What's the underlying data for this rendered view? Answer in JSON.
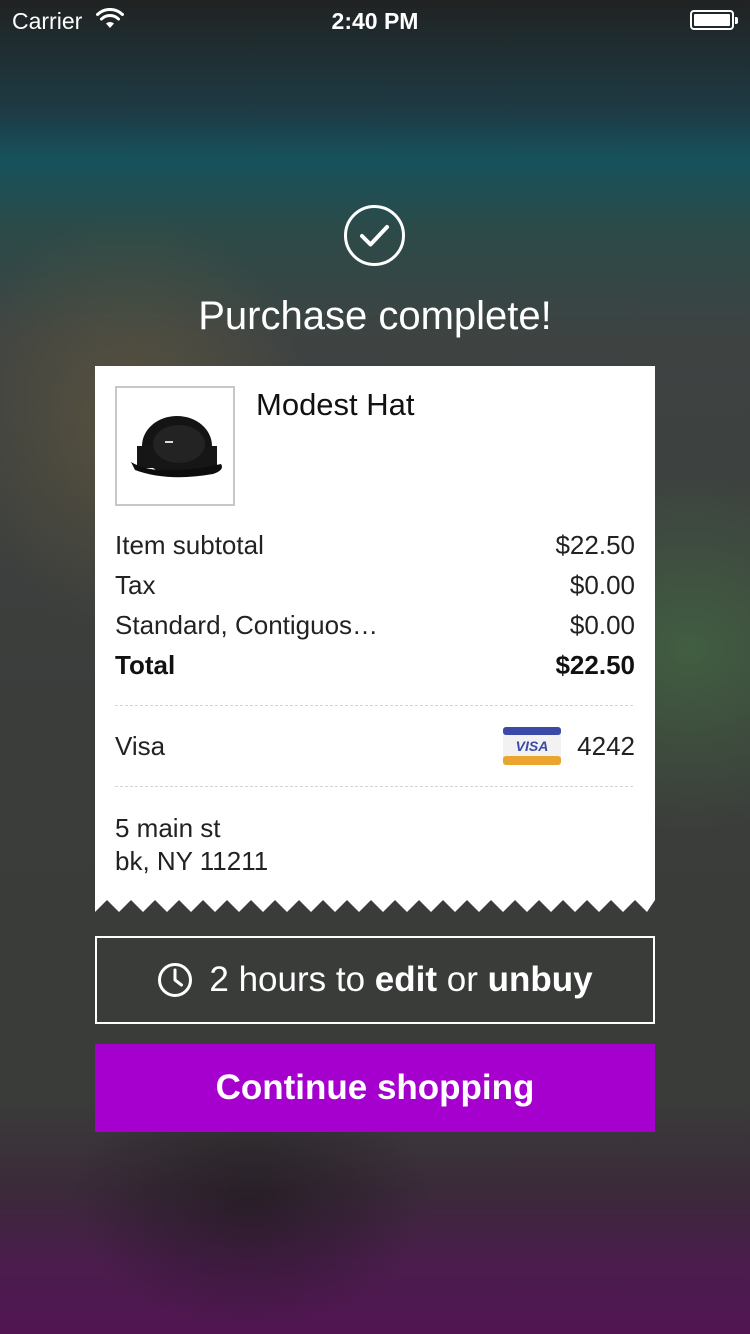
{
  "status_bar": {
    "carrier": "Carrier",
    "time": "2:40 PM",
    "wifi_icon": "wifi-icon",
    "battery_icon": "battery-icon"
  },
  "header": {
    "icon": "check-circle-icon",
    "title": "Purchase complete!"
  },
  "receipt": {
    "product": {
      "name": "Modest Hat",
      "image": "black snapback cap"
    },
    "lines": [
      {
        "label": "Item subtotal",
        "value": "$22.50"
      },
      {
        "label": "Tax",
        "value": "$0.00"
      },
      {
        "label": "Standard, Contiguos…",
        "value": "$0.00"
      }
    ],
    "total": {
      "label": "Total",
      "value": "$22.50"
    },
    "payment": {
      "method": "Visa",
      "card_icon": "visa-card-icon",
      "card_logo_text": "VISA",
      "last4": "4242"
    },
    "address": {
      "line1": "5 main st",
      "line2": "bk, NY 11211"
    }
  },
  "timer": {
    "icon": "clock-icon",
    "prefix": "2 hours to ",
    "edit": "edit",
    "middle": " or ",
    "unbuy": "unbuy"
  },
  "continue_button": {
    "label": "Continue shopping"
  },
  "colors": {
    "accent": "#a600cf",
    "card_bg": "#ffffff",
    "visa_blue": "#3a4aa6",
    "visa_gold": "#e9a530"
  }
}
